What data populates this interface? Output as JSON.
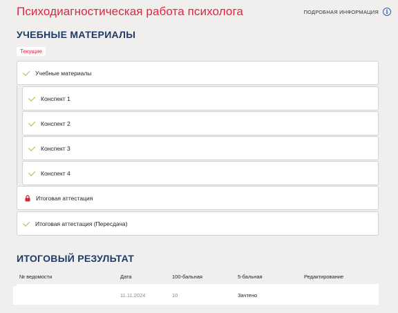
{
  "header": {
    "title": "Психодиагностическая работа психолога",
    "info_link": "ПОДРОБНАЯ ИНФОРМАЦИЯ",
    "info_icon": "info-icon"
  },
  "materials": {
    "section_title": "УЧЕБНЫЕ МАТЕРИАЛЫ",
    "chip_label": "Текущие",
    "items": [
      {
        "label": "Учебные материалы",
        "icon": "check-icon"
      },
      {
        "label": "Конспект 1",
        "icon": "check-icon"
      },
      {
        "label": "Конспект 2",
        "icon": "check-icon"
      },
      {
        "label": "Конспект 3",
        "icon": "check-icon"
      },
      {
        "label": "Конспект 4",
        "icon": "check-icon"
      },
      {
        "label": "Итоговая аттестация",
        "icon": "lock-icon"
      },
      {
        "label": "Итоговая аттестация (Пересдача)",
        "icon": "check-icon"
      }
    ]
  },
  "results": {
    "section_title": "ИТОГОВЫЙ РЕЗУЛЬТАТ",
    "columns": [
      "№ ведомости",
      "Дата",
      "100-бальная",
      "5-бальная",
      "Редактирование"
    ],
    "rows": [
      {
        "sheet": "",
        "date": "11.11.2024",
        "score100": "10",
        "score5": "Зачтено",
        "edit": ""
      }
    ]
  },
  "colors": {
    "accent": "#e0253c",
    "heading": "#1e3a68",
    "check": "#8dc63f"
  }
}
